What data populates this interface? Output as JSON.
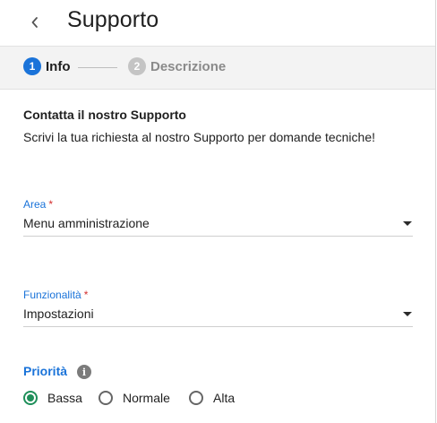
{
  "header": {
    "title": "Supporto"
  },
  "stepper": {
    "steps": [
      {
        "number": "1",
        "label": "Info"
      },
      {
        "number": "2",
        "label": "Descrizione"
      }
    ]
  },
  "content": {
    "heading": "Contatta il nostro Supporto",
    "description": "Scrivi la tua richiesta al nostro Supporto per domande tecniche!"
  },
  "fields": {
    "area": {
      "label": "Area",
      "required_mark": "*",
      "value": "Menu amministrazione"
    },
    "feature": {
      "label": "Funzionalità",
      "required_mark": "*",
      "value": "Impostazioni"
    }
  },
  "priority": {
    "label": "Priorità",
    "info_glyph": "i",
    "options": [
      {
        "label": "Bassa",
        "selected": true
      },
      {
        "label": "Normale",
        "selected": false
      },
      {
        "label": "Alta",
        "selected": false
      }
    ]
  },
  "colors": {
    "accent": "#1a73d9",
    "radio_selected": "#1f8f5a",
    "required": "#d32f2f"
  }
}
